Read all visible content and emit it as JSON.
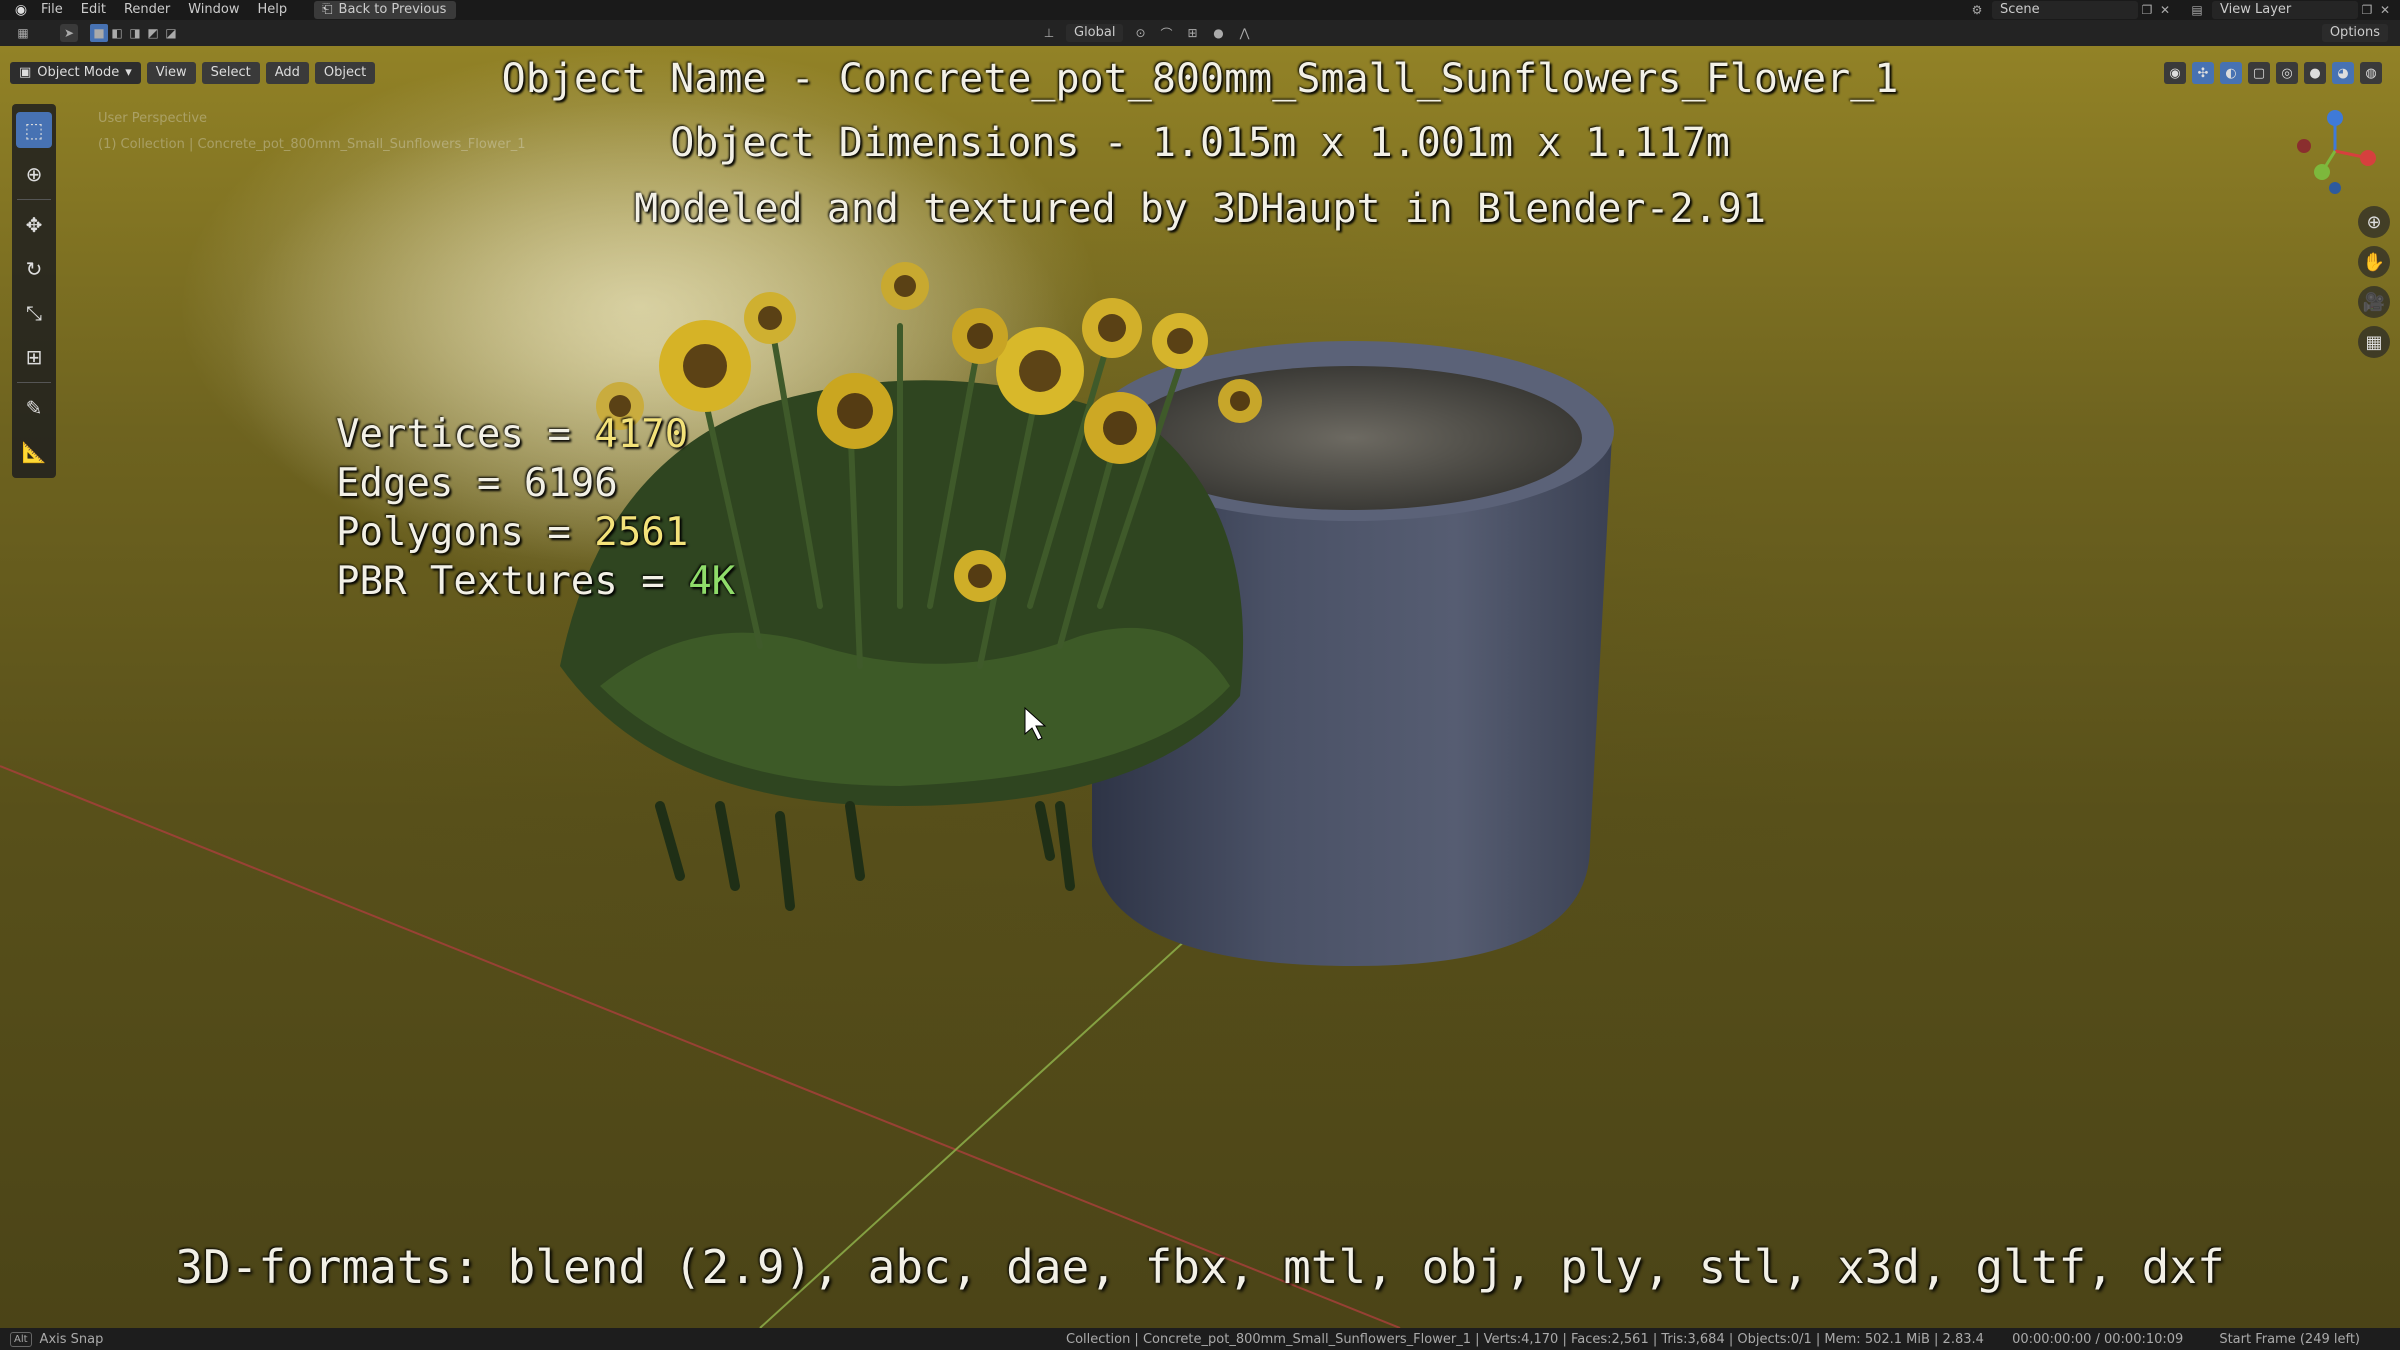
{
  "topbar": {
    "menu": [
      "File",
      "Edit",
      "Render",
      "Window",
      "Help"
    ],
    "back_label": "Back to Previous",
    "scene_label": "Scene",
    "view_layer_label": "View Layer"
  },
  "header": {
    "orientation_label": "Global",
    "options_label": "Options"
  },
  "viewport": {
    "mode_label": "Object Mode",
    "menu": [
      "View",
      "Select",
      "Add",
      "Object"
    ],
    "info_line1": "User Perspective",
    "info_line2": "(1) Collection | Concrete_pot_800mm_Small_Sunflowers_Flower_1"
  },
  "overlay": {
    "name_line": "Object Name - Concrete_pot_800mm_Small_Sunflowers_Flower_1",
    "dimensions_line": "Object Dimensions -  1.015m x 1.001m x 1.117m",
    "credit_line": "Modeled and textured by 3DHaupt in Blender-2.91",
    "stats": {
      "vertices_label": "Vertices = ",
      "vertices_value": "4170",
      "edges_label": "Edges = ",
      "edges_value": "6196",
      "polygons_label": "Polygons = ",
      "polygons_value": "2561",
      "textures_label": "PBR Textures = ",
      "textures_value": "4K"
    },
    "formats_line": "3D-formats: blend (2.9), abc, dae, fbx, mtl, obj, ply, stl, x3d, gltf, dxf"
  },
  "statusbar": {
    "key_label": "Alt",
    "left_label": "Axis Snap",
    "center_info": "Collection | Concrete_pot_800mm_Small_Sunflowers_Flower_1 | Verts:4,170 | Faces:2,561 | Tris:3,684 | Objects:0/1 | Mem: 502.1 MiB | 2.83.4",
    "time_info": "00:00:00:00 / 00:00:10:09",
    "frame_info": "Start Frame (249 left)"
  },
  "colors": {
    "accent": "#4772b3",
    "stat_value_yellow": "#f3e27a",
    "stat_value_green": "#8fdc6a"
  }
}
